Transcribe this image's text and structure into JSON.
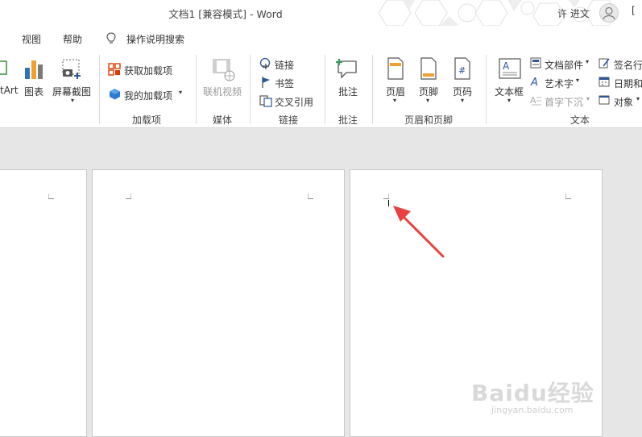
{
  "window": {
    "title": "文档1 [兼容模式] - Word",
    "user": "许 进文",
    "side_button": "["
  },
  "menu": {
    "items": [
      "视图",
      "帮助"
    ],
    "tellme": "操作说明搜索"
  },
  "ribbon": {
    "illustrations": {
      "smartart": "tArt",
      "chart": "图表",
      "screenshot": "屏幕截图"
    },
    "addins": {
      "get": "获取加载项",
      "my": "我的加载项",
      "group": "加载项"
    },
    "media": {
      "online_video": "联机视频",
      "group": "媒体"
    },
    "links": {
      "link": "链接",
      "bookmark": "书签",
      "crossref": "交叉引用",
      "group": "链接"
    },
    "comments": {
      "comment": "批注",
      "group": "批注"
    },
    "header_footer": {
      "header": "页眉",
      "footer": "页脚",
      "page_number": "页码",
      "group": "页眉和页脚"
    },
    "text": {
      "textbox": "文本框",
      "quickparts": "文档部件",
      "wordart": "艺术字",
      "dropcap": "首字下沉",
      "signature": "签名行",
      "datetime": "日期和",
      "object": "对象",
      "group": "文本"
    }
  },
  "watermark": {
    "brand": "Baidu经验",
    "url": "jingyan.baidu.com"
  },
  "colors": {
    "arrow": "#e8413f",
    "accent": "#2b579a"
  }
}
